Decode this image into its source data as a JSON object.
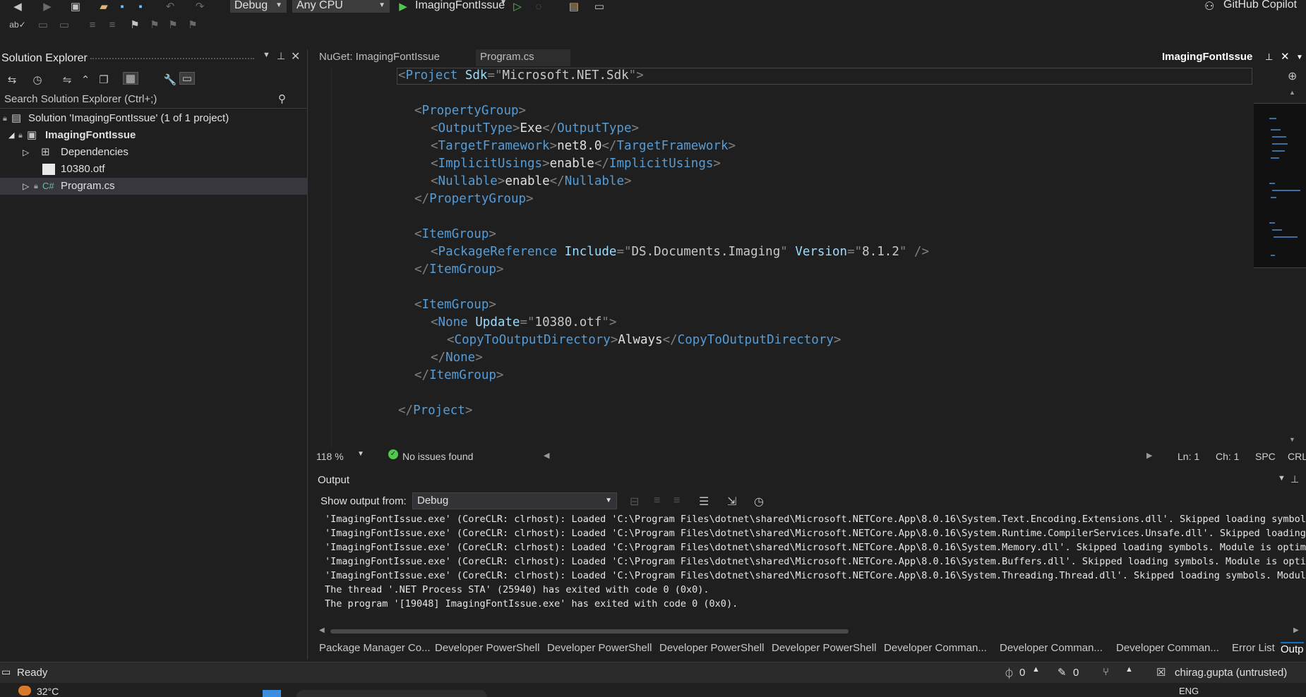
{
  "toolbar": {
    "config_value": "Debug",
    "platform_value": "Any CPU",
    "startup_project": "ImagingFontIssue",
    "copilot_label": "GitHub Copilot"
  },
  "solution_explorer": {
    "title": "Solution Explorer",
    "search_placeholder": "Search Solution Explorer (Ctrl+;)",
    "items": [
      {
        "label": "Solution 'ImagingFontIssue' (1 of 1 project)"
      },
      {
        "label": "ImagingFontIssue"
      },
      {
        "label": "Dependencies"
      },
      {
        "label": "10380.otf"
      },
      {
        "label": "Program.cs"
      }
    ]
  },
  "tabs": {
    "nuget": "NuGet: ImagingFontIssue",
    "program": "Program.cs",
    "active": "ImagingFontIssue"
  },
  "code": {
    "project_open": "Project",
    "sdk_attr": "Sdk",
    "sdk_value": "Microsoft.NET.Sdk",
    "property_group": "PropertyGroup",
    "output_type_tag": "OutputType",
    "output_type_value": "Exe",
    "target_framework_tag": "TargetFramework",
    "target_framework_value": "net8.0",
    "implicit_usings_tag": "ImplicitUsings",
    "implicit_usings_value": "enable",
    "nullable_tag": "Nullable",
    "nullable_value": "enable",
    "item_group": "ItemGroup",
    "package_reference_tag": "PackageReference",
    "include_attr": "Include",
    "include_value": "DS.Documents.Imaging",
    "version_attr": "Version",
    "version_value": "8.1.2",
    "none_tag": "None",
    "update_attr": "Update",
    "update_value": "10380.otf",
    "copy_tag": "CopyToOutputDirectory",
    "copy_value": "Always"
  },
  "editor_status": {
    "zoom": "118 %",
    "issues": "No issues found",
    "line": "Ln: 1",
    "col": "Ch: 1",
    "spc": "SPC",
    "crlf": "CRL"
  },
  "output": {
    "title": "Output",
    "show_from_label": "Show output from:",
    "source": "Debug",
    "lines": [
      "'ImagingFontIssue.exe' (CoreCLR: clrhost): Loaded 'C:\\Program Files\\dotnet\\shared\\Microsoft.NETCore.App\\8.0.16\\System.Text.Encoding.Extensions.dll'. Skipped loading symbols.",
      "'ImagingFontIssue.exe' (CoreCLR: clrhost): Loaded 'C:\\Program Files\\dotnet\\shared\\Microsoft.NETCore.App\\8.0.16\\System.Runtime.CompilerServices.Unsafe.dll'. Skipped loading s",
      "'ImagingFontIssue.exe' (CoreCLR: clrhost): Loaded 'C:\\Program Files\\dotnet\\shared\\Microsoft.NETCore.App\\8.0.16\\System.Memory.dll'. Skipped loading symbols. Module is optimiz",
      "'ImagingFontIssue.exe' (CoreCLR: clrhost): Loaded 'C:\\Program Files\\dotnet\\shared\\Microsoft.NETCore.App\\8.0.16\\System.Buffers.dll'. Skipped loading symbols. Module is optimi",
      "'ImagingFontIssue.exe' (CoreCLR: clrhost): Loaded 'C:\\Program Files\\dotnet\\shared\\Microsoft.NETCore.App\\8.0.16\\System.Threading.Thread.dll'. Skipped loading symbols. Module",
      "The thread '.NET Process STA' (25940) has exited with code 0 (0x0).",
      "The program '[19048] ImagingFontIssue.exe' has exited with code 0 (0x0)."
    ]
  },
  "bottom_tabs": [
    "Package Manager Co...",
    "Developer PowerShell",
    "Developer PowerShell",
    "Developer PowerShell",
    "Developer PowerShell",
    "Developer Comman...",
    "Developer Comman...",
    "Developer Comman...",
    "Error List",
    "Outp"
  ],
  "statusbar": {
    "ready": "Ready",
    "errors": "0",
    "edits": "0",
    "user": "chirag.gupta (untrusted)"
  },
  "taskbar": {
    "weather": "32°C",
    "lang": "ENG"
  }
}
